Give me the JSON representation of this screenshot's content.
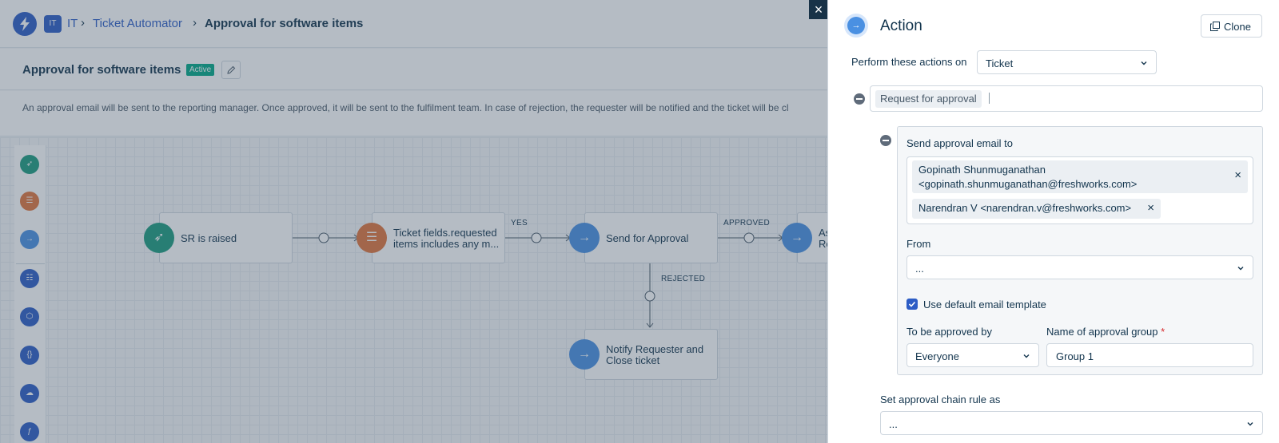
{
  "breadcrumb": {
    "badge": "IT",
    "items": [
      "IT",
      "Ticket Automator",
      "Approval for software items"
    ]
  },
  "workflow": {
    "title": "Approval for software items",
    "status": "Active",
    "description": "An approval email will be sent to the reporting manager. Once approved, it will be sent to the fulfilment team. In case of rejection, the requester will be notified and the ticket will be cl"
  },
  "palette": [
    "event-icon",
    "condition-icon",
    "action-icon",
    "reader-icon",
    "app-icon",
    "expression-icon",
    "cloud-icon",
    "function-icon"
  ],
  "nodes": {
    "event": "SR is raised",
    "condition": "Ticket fields.requested items includes any m...",
    "approval": "Send for Approval",
    "notify": "Notify Requester and Close ticket",
    "assign": "Assig Requ"
  },
  "edges": {
    "yes": "YES",
    "approved": "APPROVED",
    "rejected": "REJECTED"
  },
  "drawer": {
    "close": "×",
    "title": "Action",
    "clone_label": "Clone",
    "perform_label": "Perform these actions on",
    "perform_value": "Ticket",
    "action_tag": "Request for approval",
    "send_to_label": "Send approval email to",
    "recipients": [
      {
        "line1": "Gopinath Shunmuganathan",
        "line2": "<gopinath.shunmuganathan@freshworks.com>"
      },
      {
        "line1": "Narendran V <narendran.v@freshworks.com>"
      }
    ],
    "remove_glyph": "×",
    "from_label": "From",
    "from_value": "...",
    "default_template_label": "Use default email template",
    "default_template_checked": true,
    "approved_by_label": "To be approved by",
    "approved_by_value": "Everyone",
    "group_name_label": "Name of approval group",
    "required_mark": "*",
    "group_name_value": "Group 1",
    "chain_rule_label": "Set approval chain rule as",
    "chain_rule_value": "..."
  },
  "colors": {
    "primary": "#2c5cc5",
    "event": "#1c9b7e",
    "condition": "#e0743c",
    "action": "#4a90e2",
    "active_badge": "#00a886"
  }
}
